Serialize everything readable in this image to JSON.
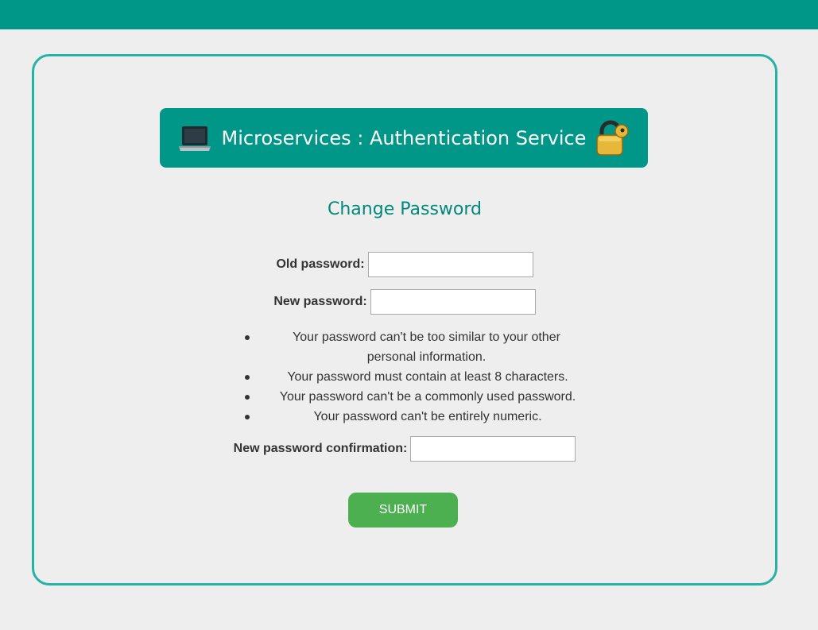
{
  "header": {
    "title": "Microservices : Authentication Service",
    "left_icon": "laptop-icon",
    "right_icon": "lock-icon"
  },
  "form": {
    "title": "Change Password",
    "old_password_label": "Old password:",
    "new_password_label": "New password:",
    "confirmation_label": "New password confirmation:",
    "old_password_value": "",
    "new_password_value": "",
    "confirmation_value": "",
    "rules": [
      "Your password can't be too similar to your other personal information.",
      "Your password must contain at least 8 characters.",
      "Your password can't be a commonly used password.",
      "Your password can't be entirely numeric."
    ],
    "submit_label": "SUBMIT"
  },
  "colors": {
    "accent": "#009688",
    "border": "#26b3a6",
    "submit": "#4caf50",
    "background": "#eeeeee"
  }
}
